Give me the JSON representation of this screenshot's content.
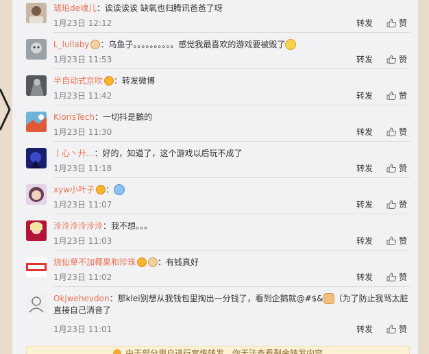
{
  "ui": {
    "repost_label": "转发",
    "like_label": "赞"
  },
  "comments": [
    {
      "name": "琥珀de魂儿",
      "text": "：诶诶诶诶 缺氧也归腾讯爸爸了呀",
      "time": "1月23日 12:12"
    },
    {
      "name": "L_lullaby",
      "text": "：乌鱼子。。。。。。。。。。感觉我最喜欢的游戏要被毁了",
      "time": "1月23日 11:53"
    },
    {
      "name": "半自动式京吹",
      "text": "：转发微博",
      "time": "1月23日 11:42"
    },
    {
      "name": "KlorisTech",
      "text": "：一切抖是鵝的",
      "time": "1月23日 11:30"
    },
    {
      "name": "丨心丶廾...",
      "text": "：好的，知道了，这个游戏以后玩不成了",
      "time": "1月23日 11:18"
    },
    {
      "name": "xyw小叶子",
      "text": "：",
      "time": "1月23日 11:07"
    },
    {
      "name": "泠泠泠泠泠泠",
      "text": "：我不想。。。",
      "time": "1月23日 11:03"
    },
    {
      "name": "烧仙草不加椰果和珍珠",
      "text": "：有钱真好",
      "time": "1月23日 11:02"
    },
    {
      "name": "Okjwehevdon",
      "text": "：那klei别想从我钱包里掏出一分钱了，看到企鹅就@#$&",
      "text2": "（为了防止我骂太脏直接自己消音了",
      "time": "1月23日 11:01"
    }
  ],
  "notice": "由于部分用户进行宣传转发，你无法查看剩余转发内容"
}
